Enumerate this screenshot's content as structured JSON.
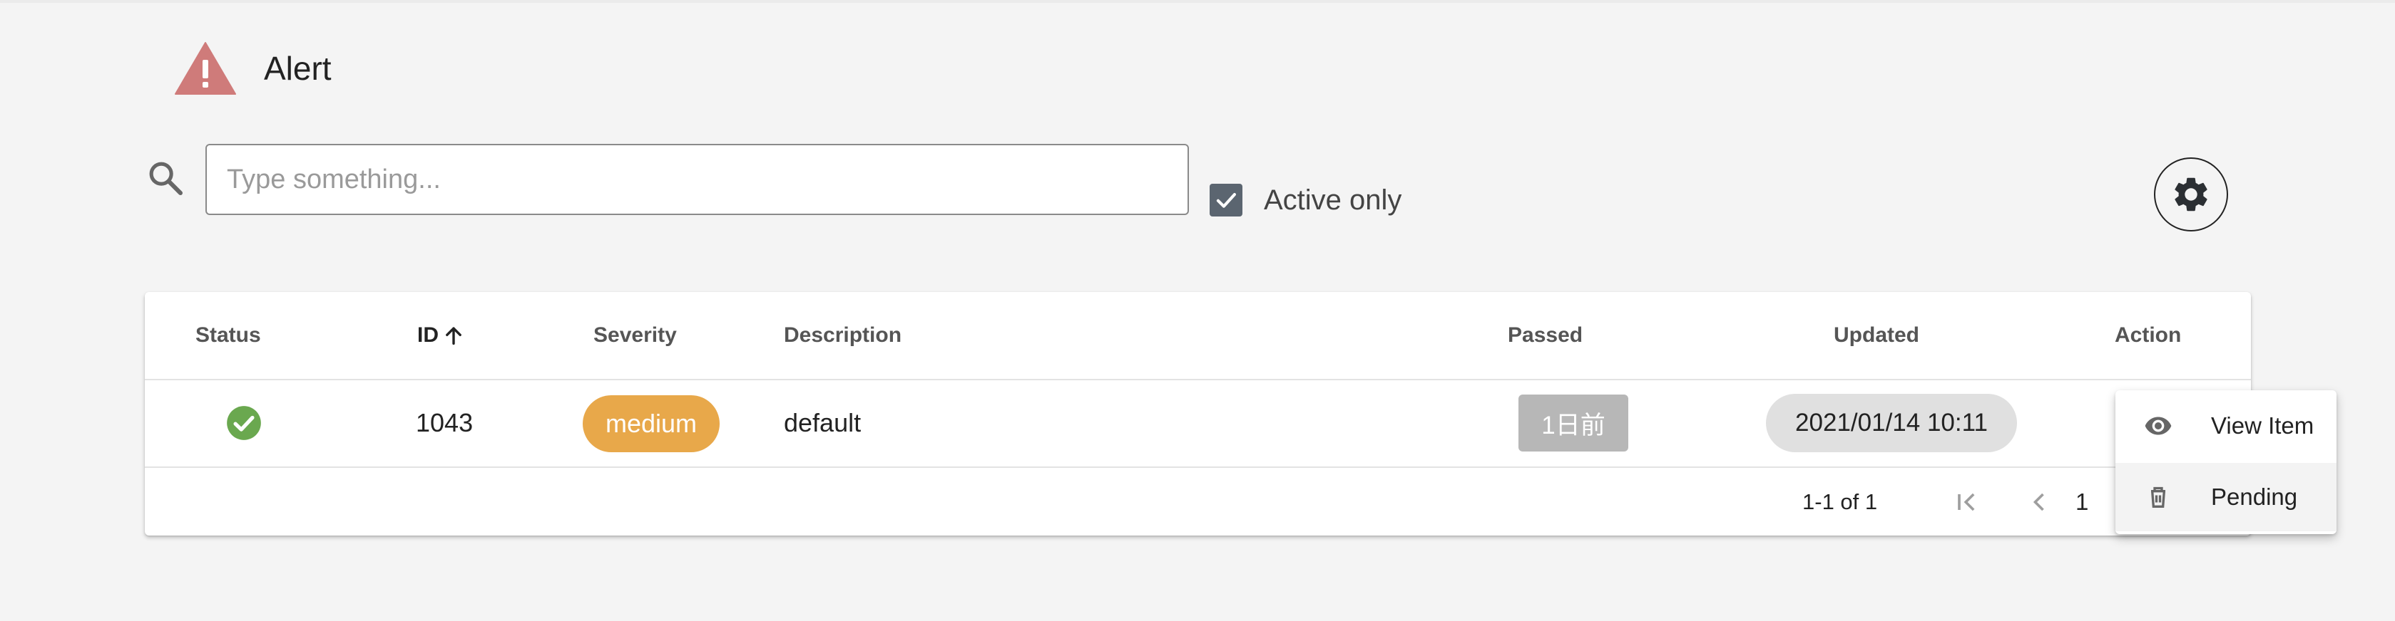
{
  "header": {
    "title": "Alert",
    "icon": "warning-triangle-icon",
    "icon_color": "#cf7b7a"
  },
  "search": {
    "placeholder": "Type something...",
    "value": ""
  },
  "filter": {
    "active_only_label": "Active only",
    "active_only_checked": true
  },
  "toolbar": {
    "settings_icon": "gear-icon"
  },
  "table": {
    "columns": [
      {
        "label": "Status"
      },
      {
        "label": "ID",
        "sorted": "ascending"
      },
      {
        "label": "Severity"
      },
      {
        "label": "Description"
      },
      {
        "label": "Passed"
      },
      {
        "label": "Updated"
      },
      {
        "label": "Action"
      }
    ],
    "rows": [
      {
        "status": "resolved",
        "status_icon": "check-circle-icon",
        "id": "1043",
        "severity": "medium",
        "description": "default",
        "passed": "1日前",
        "updated": "2021/01/14 10:11"
      }
    ],
    "pagination": {
      "range": "1-1 of 1",
      "page": "1"
    }
  },
  "action_menu": {
    "items": [
      {
        "label": "View Item",
        "icon": "eye-icon"
      },
      {
        "label": "Pending",
        "icon": "trash-icon"
      }
    ]
  },
  "colors": {
    "severity_medium": "#e8a84a",
    "status_ok": "#6aa84f",
    "checkbox": "#5b6570",
    "passed_badge": "#b7b7b7",
    "updated_badge": "#e0e0e0"
  }
}
